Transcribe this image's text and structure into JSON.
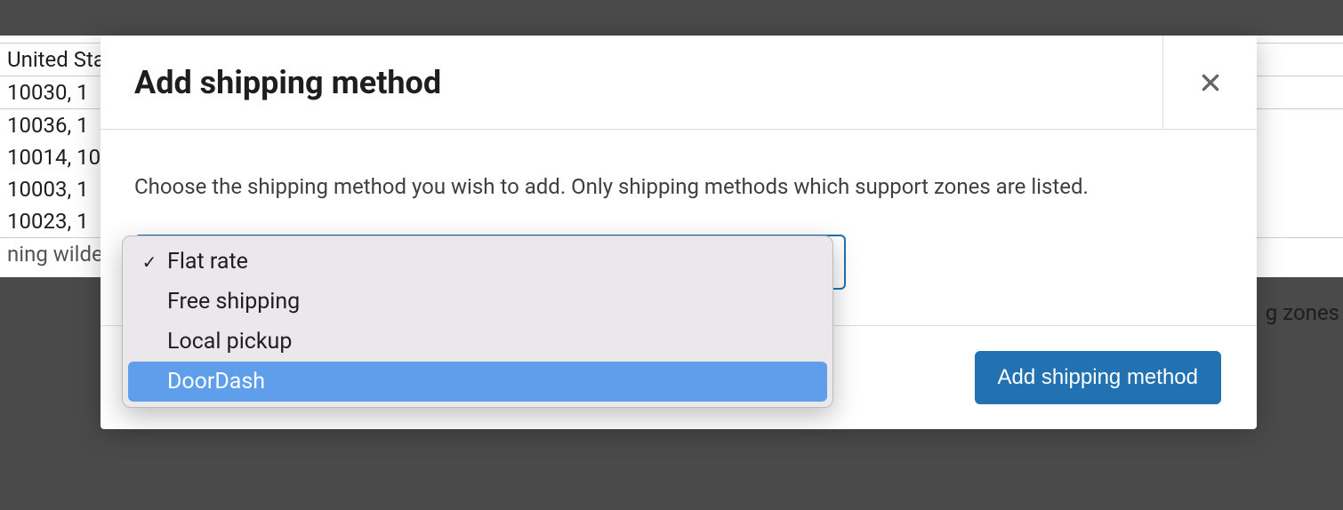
{
  "background": {
    "country": "United Sta",
    "rows": [
      "10030, 1",
      "10036, 1",
      "10014, 10",
      " 10003, 1",
      "10023, 1"
    ],
    "hint_left": "ning wilde",
    "hint_right": "g zones"
  },
  "modal": {
    "title": "Add shipping method",
    "description": "Choose the shipping method you wish to add. Only shipping methods which support zones are listed.",
    "submit_label": "Add shipping method"
  },
  "dropdown": {
    "items": [
      {
        "label": "Flat rate",
        "selected": true,
        "hover": false
      },
      {
        "label": "Free shipping",
        "selected": false,
        "hover": false
      },
      {
        "label": "Local pickup",
        "selected": false,
        "hover": false
      },
      {
        "label": "DoorDash",
        "selected": false,
        "hover": true
      }
    ]
  }
}
